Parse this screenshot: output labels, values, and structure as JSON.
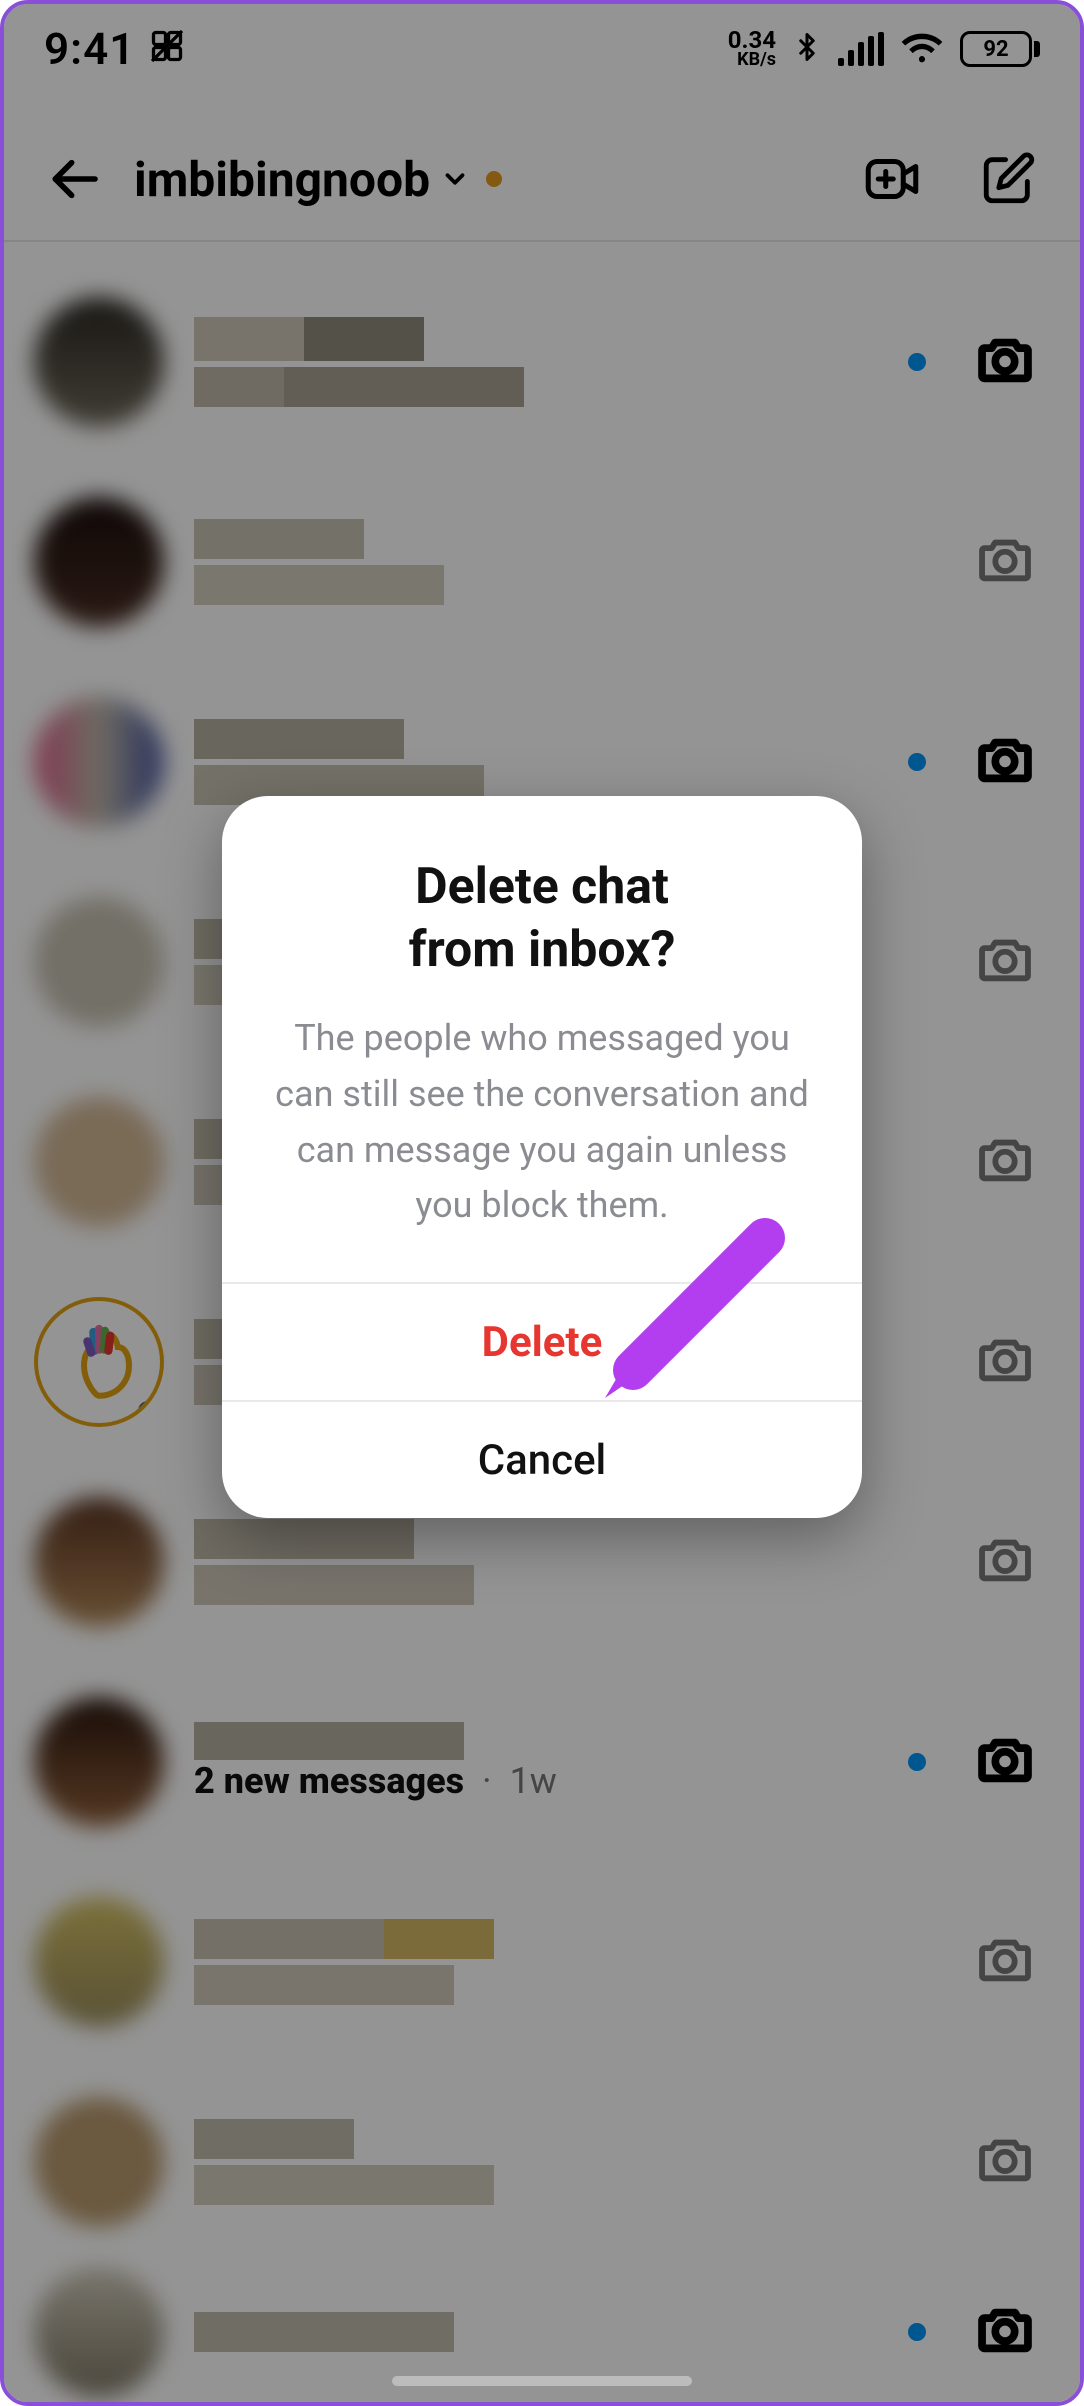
{
  "status": {
    "time": "9:41",
    "kbs_num": "0.34",
    "kbs_unit": "KB/s",
    "battery": "92"
  },
  "nav": {
    "username": "imbibingnoob"
  },
  "dialog": {
    "title_line1": "Delete chat",
    "title_line2": "from inbox?",
    "body": "The people who messaged you can still see the conversation and can message you again unless you block them.",
    "delete_label": "Delete",
    "cancel_label": "Cancel"
  },
  "row8": {
    "messages": "2 new messages",
    "sep": "·",
    "age": "1w"
  },
  "rows": [
    {
      "unread": true,
      "bold": true
    },
    {
      "unread": false,
      "bold": false
    },
    {
      "unread": true,
      "bold": true
    },
    {
      "unread": false,
      "bold": false
    },
    {
      "unread": false,
      "bold": false
    },
    {
      "unread": false,
      "bold": false
    },
    {
      "unread": false,
      "bold": false
    },
    {
      "unread": true,
      "bold": true
    },
    {
      "unread": false,
      "bold": false
    },
    {
      "unread": false,
      "bold": false
    },
    {
      "unread": true,
      "bold": true
    }
  ]
}
